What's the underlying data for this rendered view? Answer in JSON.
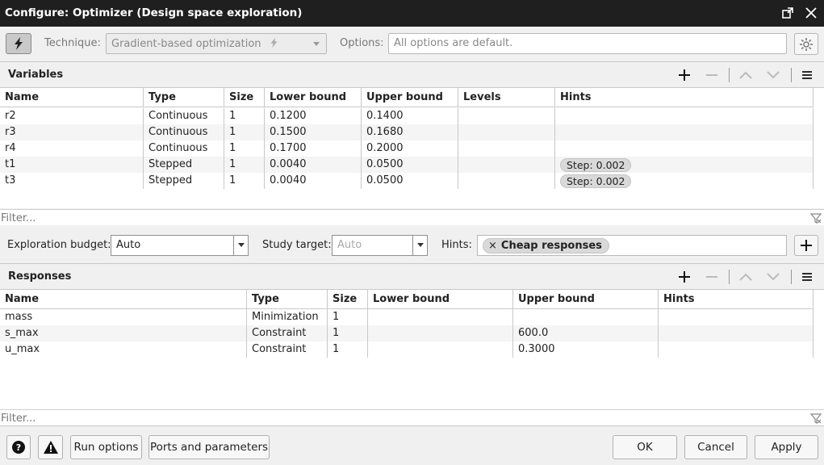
{
  "window": {
    "title": "Configure: Optimizer (Design space exploration)"
  },
  "toolbar": {
    "technique_label": "Technique:",
    "technique_value": "Gradient-based optimization",
    "options_label": "Options:",
    "options_value": "All options are default."
  },
  "variables": {
    "title": "Variables",
    "columns": [
      "Name",
      "Type",
      "Size",
      "Lower bound",
      "Upper bound",
      "Levels",
      "Hints"
    ],
    "rows": [
      {
        "name": "r2",
        "type": "Continuous",
        "size": "1",
        "lower": "0.1200",
        "upper": "0.1400",
        "levels": "",
        "hint": ""
      },
      {
        "name": "r3",
        "type": "Continuous",
        "size": "1",
        "lower": "0.1500",
        "upper": "0.1680",
        "levels": "",
        "hint": ""
      },
      {
        "name": "r4",
        "type": "Continuous",
        "size": "1",
        "lower": "0.1700",
        "upper": "0.2000",
        "levels": "",
        "hint": ""
      },
      {
        "name": "t1",
        "type": "Stepped",
        "size": "1",
        "lower": "0.0040",
        "upper": "0.0500",
        "levels": "",
        "hint": "Step: 0.002"
      },
      {
        "name": "t3",
        "type": "Stepped",
        "size": "1",
        "lower": "0.0040",
        "upper": "0.0500",
        "levels": "",
        "hint": "Step: 0.002"
      }
    ],
    "filter_placeholder": "Filter..."
  },
  "exploration": {
    "budget_label": "Exploration budget:",
    "budget_value": "Auto",
    "target_label": "Study target:",
    "target_value": "Auto",
    "hints_label": "Hints:",
    "hint_chip": "Cheap responses"
  },
  "responses": {
    "title": "Responses",
    "columns": [
      "Name",
      "Type",
      "Size",
      "Lower bound",
      "Upper bound",
      "Hints"
    ],
    "rows": [
      {
        "name": "mass",
        "type": "Minimization",
        "size": "1",
        "lower": "",
        "upper": "",
        "hint": ""
      },
      {
        "name": "s_max",
        "type": "Constraint",
        "size": "1",
        "lower": "",
        "upper": "600.0",
        "hint": ""
      },
      {
        "name": "u_max",
        "type": "Constraint",
        "size": "1",
        "lower": "",
        "upper": "0.3000",
        "hint": ""
      }
    ],
    "filter_placeholder": "Filter..."
  },
  "footer": {
    "run_options": "Run options",
    "ports_parameters": "Ports and parameters",
    "ok": "OK",
    "cancel": "Cancel",
    "apply": "Apply"
  },
  "icons": [
    "lightning-icon",
    "maximize-icon",
    "close-icon",
    "gear-icon",
    "plus-icon",
    "minus-icon",
    "arrow-up-icon",
    "arrow-down-icon",
    "menu-icon",
    "filter-clear-icon",
    "help-icon",
    "warning-icon"
  ]
}
